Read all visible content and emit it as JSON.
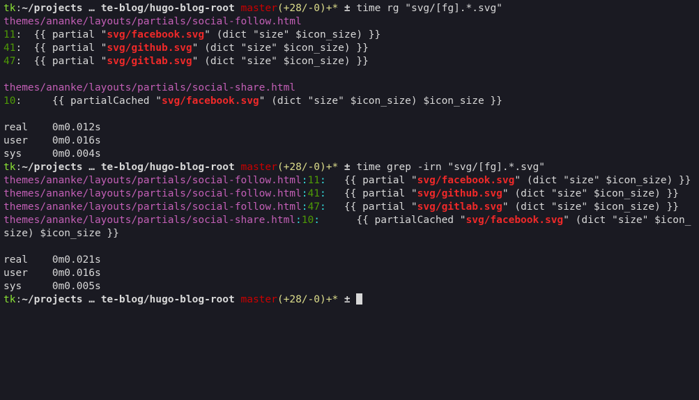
{
  "prompt1": {
    "user": "tk",
    "sep": ":",
    "path": "~/projects … te-blog/hugo-blog-root",
    "branch": "master",
    "diff": "(+28/-0)",
    "dirty": "+*",
    "sym": " ± ",
    "cmd": "time rg \"svg/[fg].*.svg\""
  },
  "rg": {
    "file1": "themes/ananke/layouts/partials/social-follow.html",
    "l11n": "11",
    "l11a": ":  {{ partial \"",
    "l11m": "svg/facebook.svg",
    "l11b": "\" (dict \"size\" $icon_size) }}",
    "l41n": "41",
    "l41a": ":  {{ partial \"",
    "l41m": "svg/github.svg",
    "l41b": "\" (dict \"size\" $icon_size) }}",
    "l47n": "47",
    "l47a": ":  {{ partial \"",
    "l47m": "svg/gitlab.svg",
    "l47b": "\" (dict \"size\" $icon_size) }}",
    "file2": "themes/ananke/layouts/partials/social-share.html",
    "l10n": "10",
    "l10a": ":     {{ partialCached \"",
    "l10m": "svg/facebook.svg",
    "l10b": "\" (dict \"size\" $icon_size) $icon_size }}"
  },
  "time1": {
    "real": "real    0m0.012s",
    "user": "user    0m0.016s",
    "sys": "sys     0m0.004s"
  },
  "prompt2": {
    "user": "tk",
    "sep": ":",
    "path": "~/projects … te-blog/hugo-blog-root",
    "branch": "master",
    "diff": "(+28/-0)",
    "dirty": "+*",
    "sym": " ± ",
    "cmd": "time grep -irn \"svg/[fg].*.svg\""
  },
  "grep": {
    "r1file": "themes/ananke/layouts/partials/social-follow.html",
    "r1c1": ":",
    "r1ln": "11",
    "r1c2": ":",
    "r1a": "   {{ partial \"",
    "r1m": "svg/facebook.svg",
    "r1b": "\" (dict \"size\" $icon_size) }}",
    "r2file": "themes/ananke/layouts/partials/social-follow.html",
    "r2c1": ":",
    "r2ln": "41",
    "r2c2": ":",
    "r2a": "   {{ partial \"",
    "r2m": "svg/github.svg",
    "r2b": "\" (dict \"size\" $icon_size) }}",
    "r3file": "themes/ananke/layouts/partials/social-follow.html",
    "r3c1": ":",
    "r3ln": "47",
    "r3c2": ":",
    "r3a": "   {{ partial \"",
    "r3m": "svg/gitlab.svg",
    "r3b": "\" (dict \"size\" $icon_size) }}",
    "r4file": "themes/ananke/layouts/partials/social-share.html",
    "r4c1": ":",
    "r4ln": "10",
    "r4c2": ":",
    "r4a": "      {{ partialCached \"",
    "r4m": "svg/facebook.svg",
    "r4b": "\" (dict \"size\" $icon_size) $icon_size }}"
  },
  "time2": {
    "real": "real    0m0.021s",
    "user": "user    0m0.016s",
    "sys": "sys     0m0.005s"
  },
  "prompt3": {
    "user": "tk",
    "sep": ":",
    "path": "~/projects … te-blog/hugo-blog-root",
    "branch": "master",
    "diff": "(+28/-0)",
    "dirty": "+*",
    "sym": " ± "
  }
}
